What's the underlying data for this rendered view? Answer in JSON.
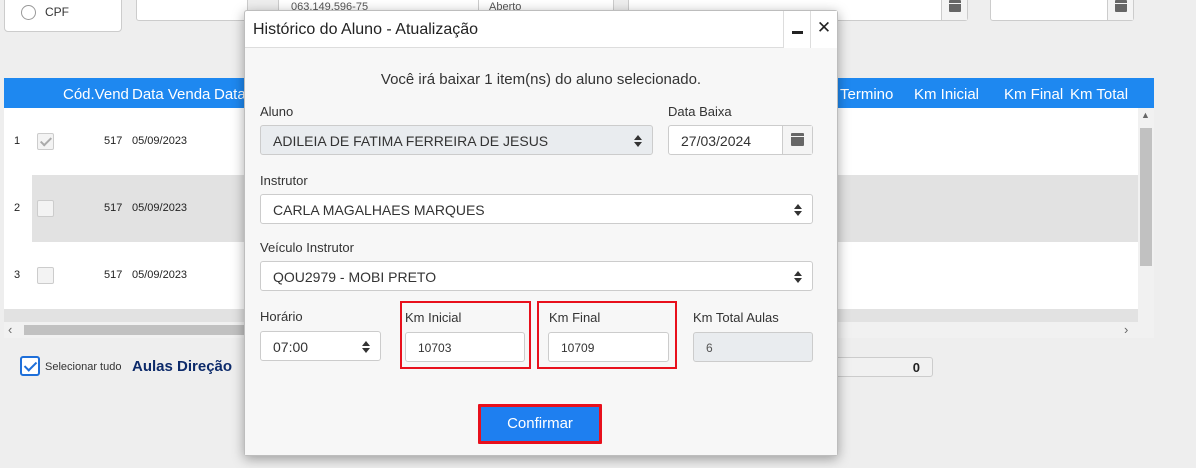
{
  "background": {
    "radio_label": "CPF",
    "top_fields": [
      "063.149.596-75",
      "Aberto"
    ],
    "grid_columns": [
      "Cód.Venda",
      "Data Venda",
      "Data",
      "Termino",
      "Km Inicial",
      "Km Final",
      "Km Total"
    ],
    "grid_rows": [
      {
        "index": "1",
        "checked": true,
        "code": "517",
        "date": "05/09/2023"
      },
      {
        "index": "2",
        "checked": false,
        "code": "517",
        "date": "05/09/2023"
      },
      {
        "index": "3",
        "checked": false,
        "code": "517",
        "date": "05/09/2023"
      }
    ],
    "select_all_label": "Selecionar tudo",
    "section_title": "Aulas Direção",
    "total_value": "0"
  },
  "modal": {
    "title": "Histórico do Aluno - Atualização",
    "info_text": "Você irá baixar 1 item(ns) do aluno selecionado.",
    "aluno_label": "Aluno",
    "aluno_value": "ADILEIA DE FATIMA FERREIRA DE JESUS",
    "data_baixa_label": "Data Baixa",
    "data_baixa_value": "27/03/2024",
    "instrutor_label": "Instrutor",
    "instrutor_value": "CARLA MAGALHAES MARQUES",
    "veiculo_label": "Veículo Instrutor",
    "veiculo_value": "QOU2979 - MOBI PRETO",
    "horario_label": "Horário",
    "horario_value": "07:00",
    "km_inicial_label": "Km Inicial",
    "km_inicial_value": "10703",
    "km_final_label": "Km Final",
    "km_final_value": "10709",
    "km_total_label": "Km Total Aulas",
    "km_total_value": "6",
    "confirm_label": "Confirmar"
  },
  "icons": [
    "calendar-icon",
    "select-arrows-icon",
    "minimize-icon",
    "close-icon",
    "checkbox-check-icon"
  ],
  "colors": {
    "accent": "#1e88f0",
    "highlight_border": "#e8101c",
    "confirm_button": "#1e7ff0",
    "section_title": "#0c2a6a"
  }
}
